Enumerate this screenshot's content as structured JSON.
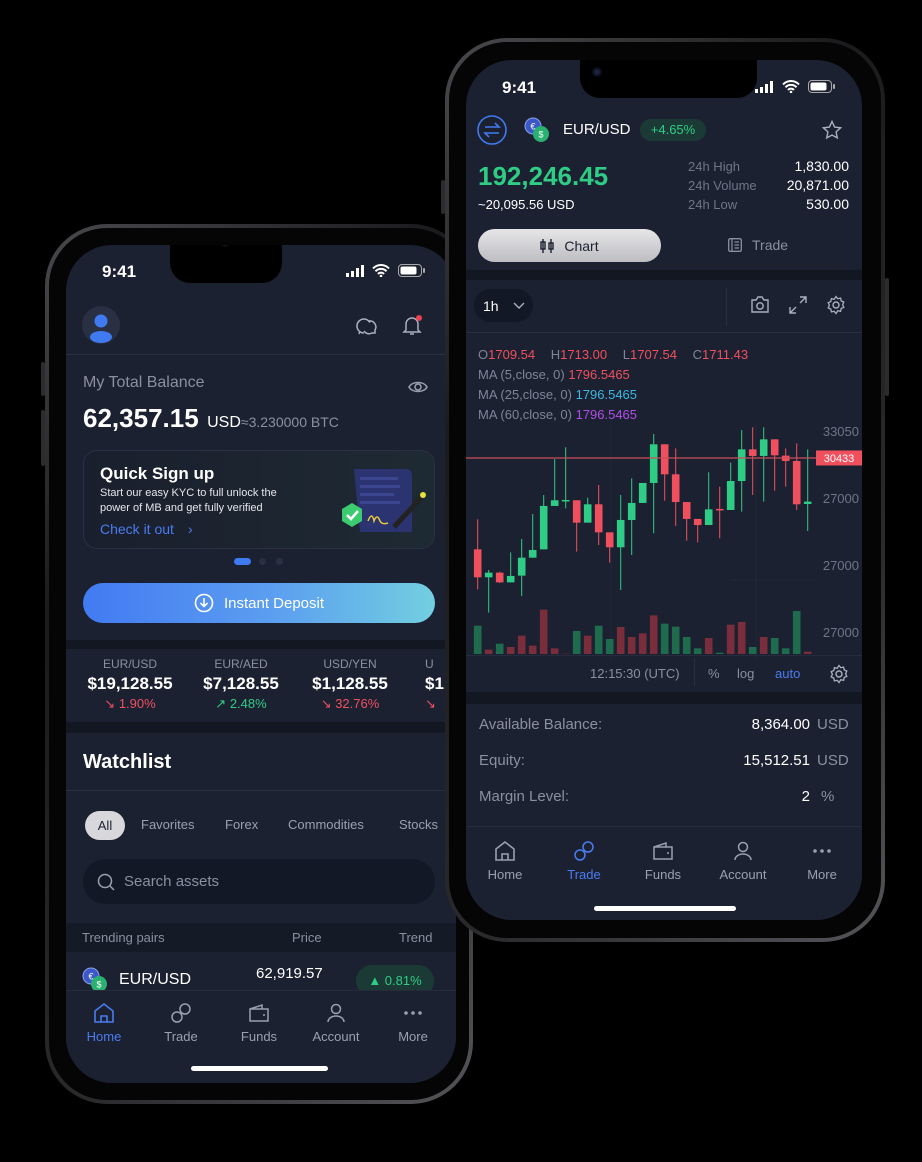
{
  "colors": {
    "accent": "#4a7cf0",
    "up": "#2ecc85",
    "down": "#f0505e",
    "bg": "#1c2131"
  },
  "left_phone": {
    "status": {
      "time": "9:41"
    },
    "header": {
      "icons": [
        "avatar-icon",
        "chat-icon",
        "bell-icon"
      ]
    },
    "balance": {
      "label": "My Total Balance",
      "amount": "62,357.15",
      "currency": "USD",
      "btc": "≈3.230000 BTC"
    },
    "promo": {
      "title": "Quick Sign up",
      "text_line1": "Start our easy KYC to full unlock the",
      "text_line2": "power of MB and get fully verified",
      "link": "Check it out"
    },
    "deposit_button": "Instant Deposit",
    "tickers": [
      {
        "pair": "EUR/USD",
        "price": "$19,128.55",
        "change": "1.90%",
        "direction": "down"
      },
      {
        "pair": "EUR/AED",
        "price": "$7,128.55",
        "change": "2.48%",
        "direction": "up"
      },
      {
        "pair": "USD/YEN",
        "price": "$1,128.55",
        "change": "32.76%",
        "direction": "down"
      },
      {
        "pair": "U",
        "price": "$1",
        "change": "",
        "direction": "down"
      }
    ],
    "watchlist": {
      "title": "Watchlist",
      "filters": [
        "All",
        "Favorites",
        "Forex",
        "Commodities",
        "Stocks"
      ],
      "active_filter": "All",
      "search_placeholder": "Search assets",
      "columns": [
        "Trending pairs",
        "Price",
        "Trend"
      ],
      "rows": [
        {
          "pair": "EUR/USD",
          "price": "62,919.57",
          "trend": "0.81%"
        }
      ]
    },
    "nav": [
      {
        "label": "Home",
        "active": true
      },
      {
        "label": "Trade"
      },
      {
        "label": "Funds"
      },
      {
        "label": "Account"
      },
      {
        "label": "More"
      }
    ]
  },
  "right_phone": {
    "status": {
      "time": "9:41"
    },
    "header": {
      "pair": "EUR/USD",
      "change": "+4.65%"
    },
    "price": {
      "value": "192,246.45",
      "approx": "~20,095.56 USD"
    },
    "stats": [
      {
        "label": "24h High",
        "value": "1,830.00"
      },
      {
        "label": "24h Volume",
        "value": "20,871.00"
      },
      {
        "label": "24h Low",
        "value": "530.00"
      }
    ],
    "tabs": {
      "chart": "Chart",
      "trade": "Trade",
      "active": "Chart"
    },
    "toolbar": {
      "interval": "1h"
    },
    "ohlc": {
      "o_label": "O",
      "o": "1709.54",
      "h_label": "H",
      "h": "1713.00",
      "l_label": "L",
      "l": "1707.54",
      "c_label": "C",
      "c": "1711.43"
    },
    "ma": [
      {
        "label": "MA (5,close, 0)",
        "value": "1796.5465",
        "color": "#f0505e"
      },
      {
        "label": "MA (25,close, 0)",
        "value": "1796.5465",
        "color": "#3bb8e0"
      },
      {
        "label": "MA (60,close, 0)",
        "value": "1796.5465",
        "color": "#b04ee8"
      }
    ],
    "chart_footer": {
      "time": "12:15:30 (UTC)",
      "percent": "%",
      "log": "log",
      "auto": "auto"
    },
    "balances": [
      {
        "label": "Available Balance:",
        "value": "8,364.00",
        "unit": "USD"
      },
      {
        "label": "Equity:",
        "value": "15,512.51",
        "unit": "USD"
      },
      {
        "label": "Margin Level:",
        "value": "2",
        "unit": "%"
      }
    ],
    "nav": [
      {
        "label": "Home"
      },
      {
        "label": "Trade",
        "active": true
      },
      {
        "label": "Funds"
      },
      {
        "label": "Account"
      },
      {
        "label": "More"
      }
    ]
  },
  "chart_data": {
    "type": "candlestick",
    "y_tick_labels": [
      "33050",
      "27000",
      "27000",
      "27000"
    ],
    "current_price_label": "30433",
    "current_price": 30433,
    "candles": [
      [
        21570,
        24480,
        17690,
        18860
      ],
      [
        18860,
        19570,
        15430,
        19310
      ],
      [
        19310,
        19400,
        18300,
        18370
      ],
      [
        18370,
        21280,
        18370,
        18990
      ],
      [
        19020,
        22580,
        17050,
        20760
      ],
      [
        20760,
        25000,
        20760,
        21510
      ],
      [
        21570,
        26840,
        21570,
        25780
      ],
      [
        25780,
        30330,
        25780,
        26330
      ],
      [
        26290,
        31470,
        25550,
        26360
      ],
      [
        26330,
        26330,
        21350,
        24160
      ],
      [
        24160,
        26580,
        24160,
        25940
      ],
      [
        25940,
        27810,
        21990,
        23220
      ],
      [
        23220,
        23220,
        20280,
        21770
      ],
      [
        21770,
        26840,
        17630,
        24420
      ],
      [
        24420,
        28460,
        21020,
        26070
      ],
      [
        26070,
        28010,
        26070,
        28010
      ],
      [
        28010,
        32760,
        23130,
        31760
      ],
      [
        31760,
        31760,
        26290,
        28850
      ],
      [
        28850,
        31370,
        23840,
        26160
      ],
      [
        26160,
        26160,
        22410,
        24520
      ],
      [
        24520,
        24520,
        22250,
        23930
      ],
      [
        23930,
        29040,
        23930,
        25450
      ],
      [
        25490,
        27650,
        22640,
        25390
      ],
      [
        25390,
        29980,
        25390,
        28200
      ],
      [
        28200,
        33150,
        25230,
        31270
      ],
      [
        31270,
        33410,
        26840,
        30630
      ],
      [
        30630,
        33410,
        26200,
        32240
      ],
      [
        32240,
        32240,
        27260,
        30690
      ],
      [
        30660,
        31370,
        27650,
        30140
      ],
      [
        30140,
        31850,
        25390,
        25940
      ],
      [
        25970,
        31270,
        23350,
        26200
      ]
    ],
    "volume": [
      85,
      13,
      31,
      21,
      55,
      25,
      133,
      17,
      1,
      69,
      55,
      85,
      45,
      81,
      51,
      62,
      116,
      91,
      82,
      51,
      17,
      48,
      4,
      88,
      96,
      21,
      51,
      48,
      17,
      129,
      7
    ],
    "volume_direction": [
      "up",
      "down",
      "up",
      "down",
      "down",
      "down",
      "down",
      "down",
      "down",
      "up",
      "down",
      "up",
      "up",
      "down",
      "down",
      "down",
      "down",
      "up",
      "up",
      "up",
      "up",
      "down",
      "up",
      "down",
      "down",
      "up",
      "down",
      "up",
      "up",
      "up",
      "down"
    ]
  }
}
